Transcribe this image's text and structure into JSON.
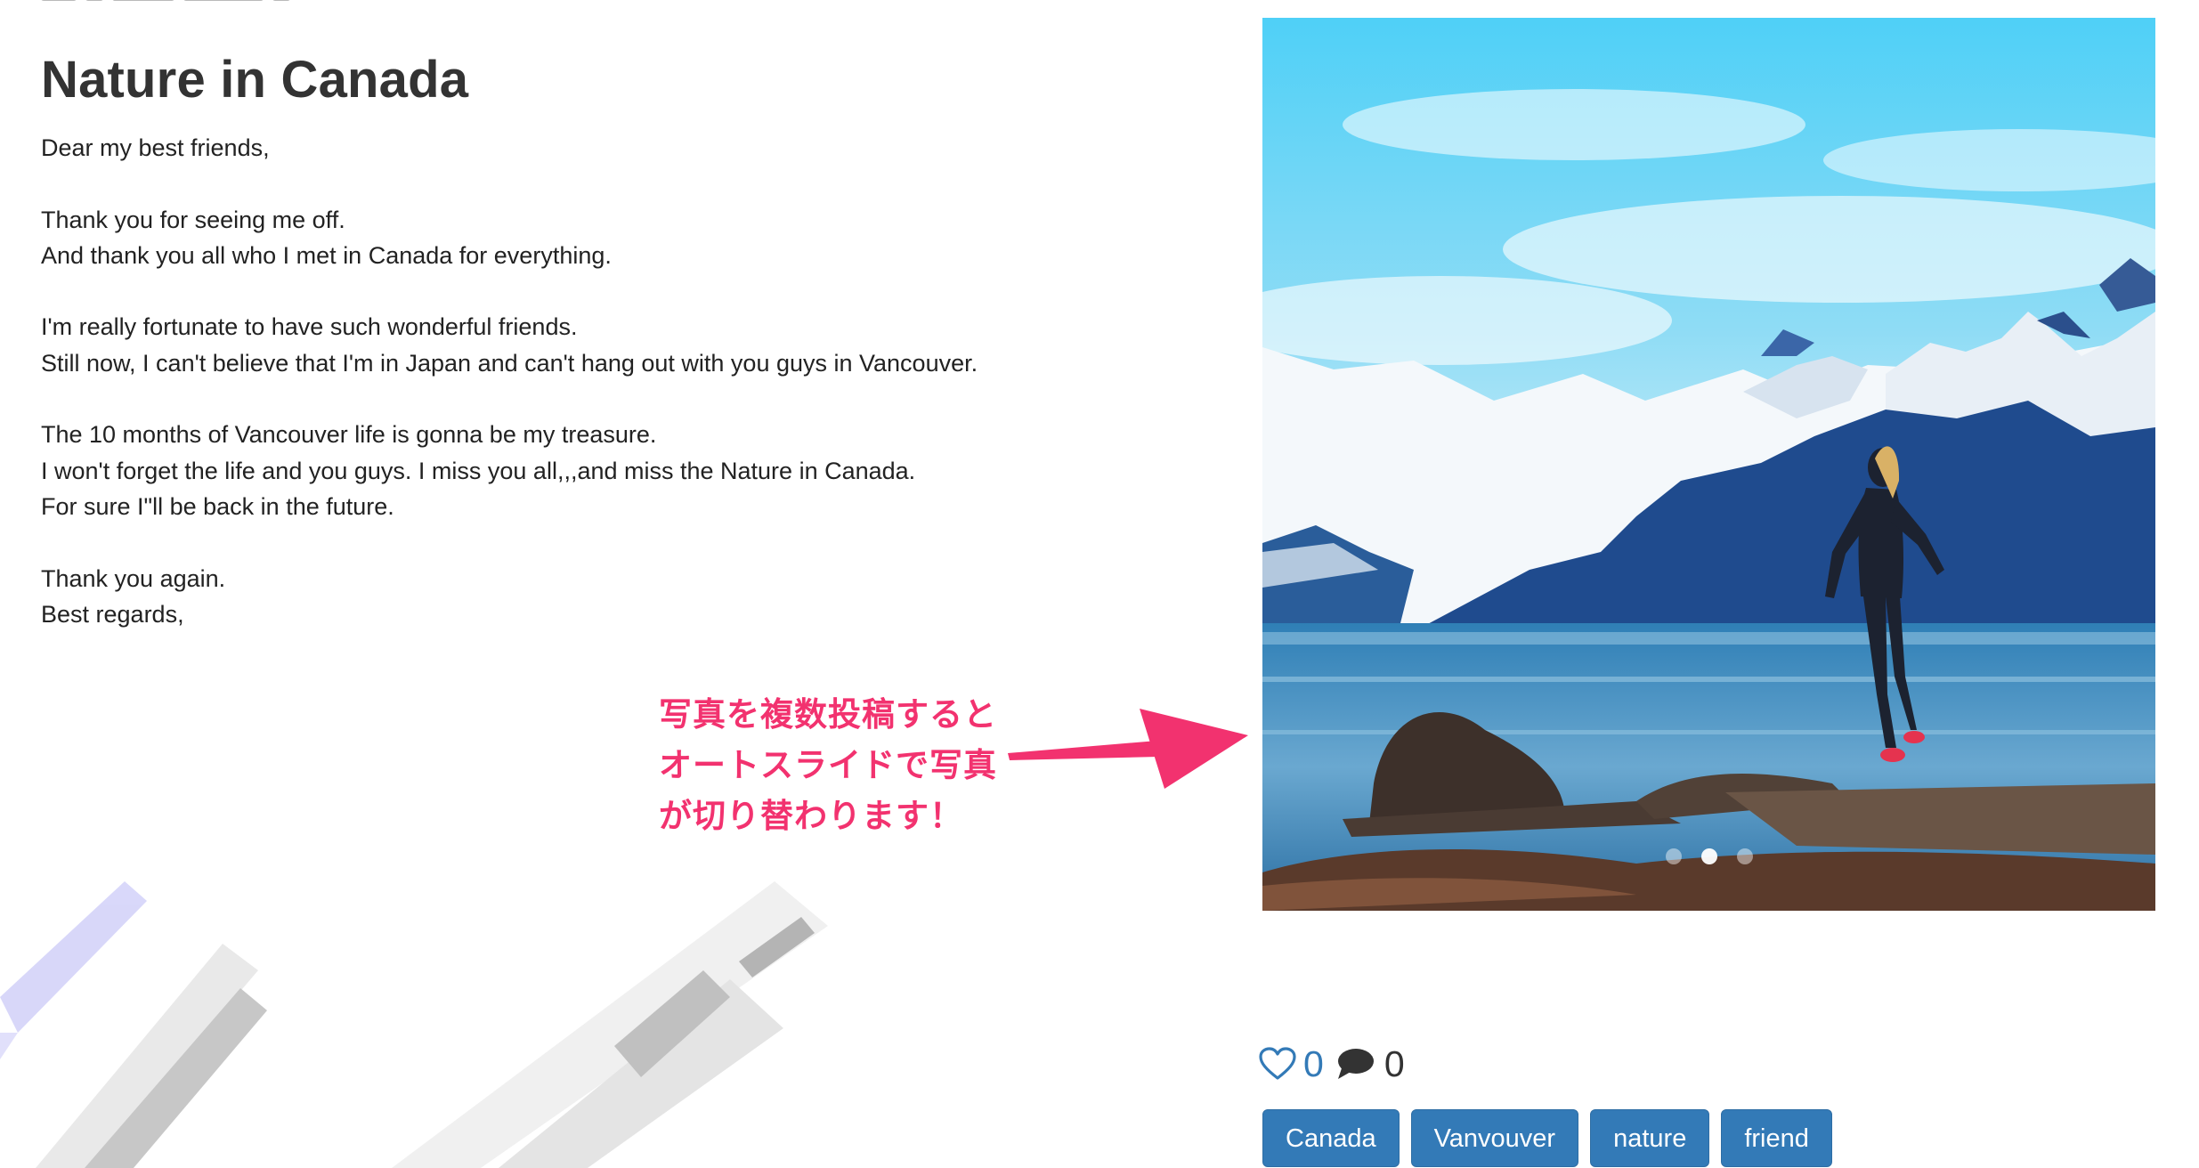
{
  "post": {
    "title": "Nature in Canada",
    "body_lines": [
      "Dear my best friends,",
      "",
      "Thank you for seeing me off.",
      "And thank you all who I met in Canada for everything.",
      "",
      "I'm really fortunate to have such wonderful friends.",
      "Still now, I can't believe that I'm in Japan and can't hang out with you guys in Vancouver.",
      "",
      "The 10 months of Vancouver life is gonna be my treasure.",
      "I won't forget the life and you guys. I miss you all,,,and miss the Nature in Canada.",
      "For sure I\"ll be back in the future.",
      "",
      "Thank you again.",
      "Best regards,"
    ]
  },
  "carousel": {
    "slide_count": 3,
    "active_index": 1
  },
  "annotation": {
    "lines": [
      "写真を複数投稿すると",
      "オートスライドで写真",
      "が切り替わります！"
    ],
    "color": "#f2326f"
  },
  "meta": {
    "like_icon": "heart-outline-icon",
    "like_count": "0",
    "comment_icon": "speech-bubble-icon",
    "comment_count": "0"
  },
  "tags": [
    "Canada",
    "Vanvouver",
    "nature",
    "friend"
  ],
  "colors": {
    "primary": "#337ab7",
    "text": "#333333",
    "annotation": "#f2326f"
  }
}
